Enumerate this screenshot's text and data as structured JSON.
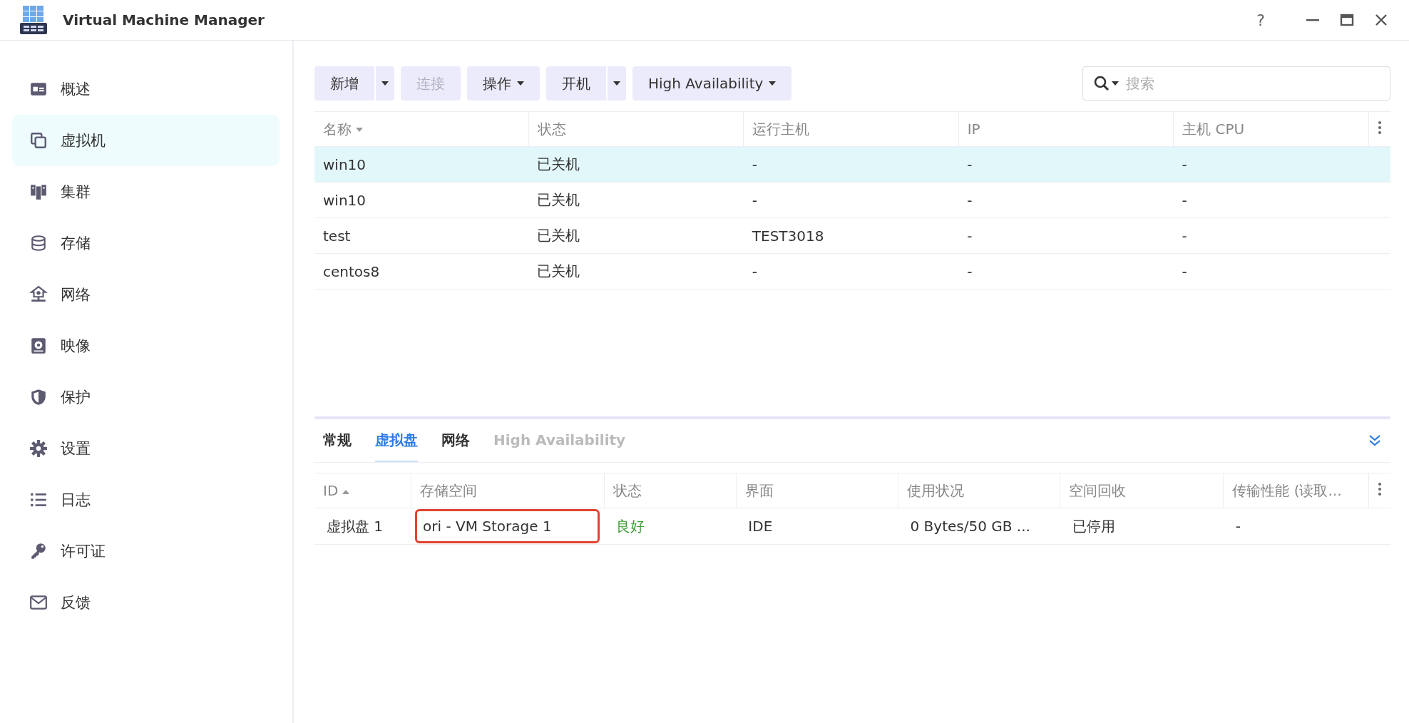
{
  "window": {
    "title": "Virtual Machine Manager",
    "help": "?"
  },
  "sidebar": {
    "items": [
      {
        "label": "概述",
        "kind": "overview",
        "selected": false
      },
      {
        "label": "虚拟机",
        "kind": "vm",
        "selected": true
      },
      {
        "label": "集群",
        "kind": "cluster",
        "selected": false
      },
      {
        "label": "存储",
        "kind": "storage",
        "selected": false
      },
      {
        "label": "网络",
        "kind": "network",
        "selected": false
      },
      {
        "label": "映像",
        "kind": "image",
        "selected": false
      },
      {
        "label": "保护",
        "kind": "protect",
        "selected": false
      },
      {
        "label": "设置",
        "kind": "settings",
        "selected": false
      },
      {
        "label": "日志",
        "kind": "log",
        "selected": false
      },
      {
        "label": "许可证",
        "kind": "license",
        "selected": false
      },
      {
        "label": "反馈",
        "kind": "feedback",
        "selected": false
      }
    ]
  },
  "toolbar": {
    "buttons": [
      {
        "label": "新增",
        "kind": "split",
        "disabled": false
      },
      {
        "label": "连接",
        "kind": "plain",
        "disabled": true
      },
      {
        "label": "操作",
        "kind": "menu",
        "disabled": false
      },
      {
        "label": "开机",
        "kind": "split",
        "disabled": false
      },
      {
        "label": "High Availability",
        "kind": "menu",
        "disabled": false
      }
    ],
    "search": {
      "placeholder": "搜索"
    }
  },
  "vm_table": {
    "columns": [
      {
        "label": "名称",
        "kind": "sortdesc"
      },
      {
        "label": "状态",
        "kind": "plain"
      },
      {
        "label": "运行主机",
        "kind": "plain"
      },
      {
        "label": "IP",
        "kind": "plain"
      },
      {
        "label": "主机 CPU",
        "kind": "plain"
      }
    ],
    "rows": [
      {
        "selected": true,
        "cells": [
          "win10",
          "已关机",
          "-",
          "-",
          "-"
        ]
      },
      {
        "selected": false,
        "cells": [
          "win10",
          "已关机",
          "-",
          "-",
          "-"
        ]
      },
      {
        "selected": false,
        "cells": [
          "test",
          "已关机",
          "TEST3018",
          "-",
          "-"
        ]
      },
      {
        "selected": false,
        "cells": [
          "centos8",
          "已关机",
          "-",
          "-",
          "-"
        ]
      }
    ]
  },
  "detail": {
    "tabs": [
      {
        "label": "常规",
        "selected": false,
        "disabled": false
      },
      {
        "label": "虚拟盘",
        "selected": true,
        "disabled": false
      },
      {
        "label": "网络",
        "selected": false,
        "disabled": false
      },
      {
        "label": "High Availability",
        "selected": false,
        "disabled": true
      }
    ],
    "disk_table": {
      "columns": [
        {
          "label": "ID",
          "kind": "sortasc"
        },
        {
          "label": "存储空间",
          "kind": "plain"
        },
        {
          "label": "状态",
          "kind": "plain"
        },
        {
          "label": "界面",
          "kind": "plain"
        },
        {
          "label": "使用状况",
          "kind": "plain"
        },
        {
          "label": "空间回收",
          "kind": "plain"
        },
        {
          "label": "传输性能 (读取...",
          "kind": "plain"
        }
      ],
      "rows": [
        {
          "selected": false,
          "cells": [
            {
              "text": "虚拟盘 1",
              "highlighted": false
            },
            {
              "text": "ori - VM Storage 1",
              "highlighted": true
            },
            {
              "text": "良好",
              "highlighted": false,
              "color": "#3c9b35"
            },
            {
              "text": "IDE",
              "highlighted": false
            },
            {
              "text": "0 Bytes/50 GB ...",
              "highlighted": false
            },
            {
              "text": "已停用",
              "highlighted": false
            },
            {
              "text": "-",
              "highlighted": false
            }
          ]
        }
      ]
    }
  }
}
